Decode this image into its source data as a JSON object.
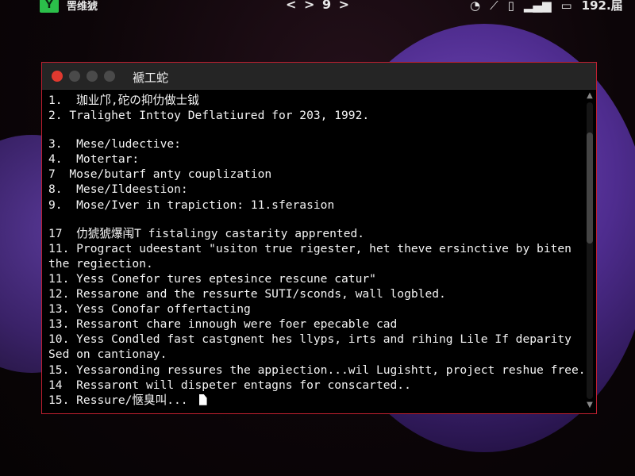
{
  "topbar": {
    "app_logo": "Y",
    "app_name": "罟维猇",
    "nav": "< > 9 >",
    "icons": [
      "timer-icon",
      "brush-icon",
      "phone-icon",
      "signal-icon",
      "chat-icon"
    ],
    "clock": "192.届"
  },
  "window": {
    "title": "褫工蛇",
    "lines": [
      "1.  珈业邝,砣の抑仂做士钺",
      "2. Tralighet Inttoy Deflatiured for 203, 1992.",
      "",
      "3.  Mese/ludective:",
      "4.  Motertar:",
      "7  Mose/butarf anty couplization",
      "8.  Mese/Ildeestion:",
      "9.  Mose/Iver in trapiction: 11.sferasion",
      "",
      "17  仂猇猇爆闱T fistalingy castarity apprented.",
      "11. Progract udeestant \"usiton true rigester, het theve ersinctive by biten the regiection.",
      "11. Yess Conefor tures eptesince rescune catur\"",
      "12. Ressarone and the ressurte SUTI/sconds, wall logbled.",
      "13. Yess Conofar offertacting",
      "13. Ressaront chare innough were foer epecable cad",
      "10. Yess Condled fast castgnent hes llyps, irts and rihing Lile If deparity Sed on cantionay.",
      "15. Yessaronding ressures the appiection...wil Lugishtt, project reshue free.",
      "14  Ressaront will dispeter entagns for conscarted..",
      "15. Ressure/惬臭叫..."
    ]
  }
}
